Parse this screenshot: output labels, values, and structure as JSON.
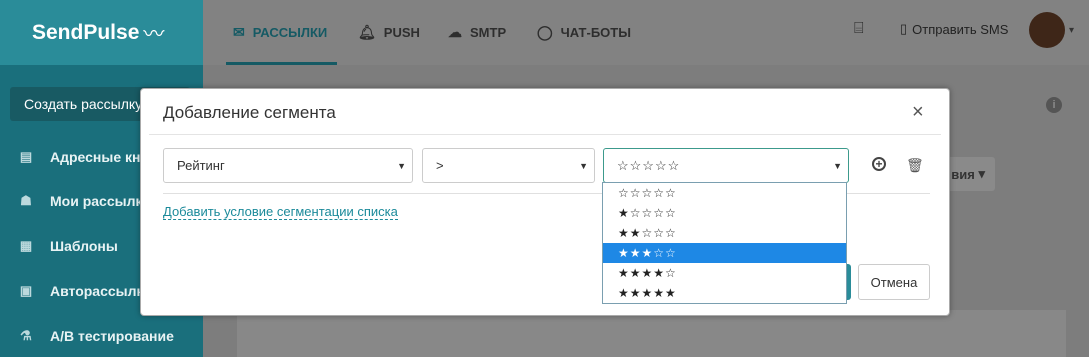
{
  "app": {
    "logo": "SendPulse",
    "logo_mark": "〰"
  },
  "sidebar": {
    "create_button": "Создать рассылку",
    "items": [
      {
        "label": "Адресные книги",
        "icon": "address-book-icon"
      },
      {
        "label": "Мои рассылки",
        "icon": "campaigns-icon"
      },
      {
        "label": "Шаблоны",
        "icon": "templates-icon"
      },
      {
        "label": "Авторассылки",
        "icon": "autoresponder-icon"
      },
      {
        "label": "A/B тестирование",
        "icon": "ab-test-icon"
      }
    ]
  },
  "topnav": {
    "items": [
      {
        "label": "РАССЫЛКИ",
        "icon": "mail-icon",
        "active": true
      },
      {
        "label": "PUSH",
        "icon": "bell-icon"
      },
      {
        "label": "SMTP",
        "icon": "cloud-icon"
      },
      {
        "label": "ЧАТ-БОТЫ",
        "icon": "chat-icon"
      }
    ],
    "sms_label": "Отправить SMS"
  },
  "background": {
    "actions_label": "вия"
  },
  "modal": {
    "title": "Добавление сегмента",
    "field_select": "Рейтинг",
    "operator_select": ">",
    "value_select": "☆☆☆☆☆",
    "add_condition_link": "Добавить условие сегментации списка",
    "cancel_button": "Отмена"
  },
  "rating_options": [
    "☆☆☆☆☆",
    "★☆☆☆☆",
    "★★☆☆☆",
    "★★★☆☆",
    "★★★★☆",
    "★★★★★"
  ],
  "selected_option_index": 3,
  "colors": {
    "sidebar": "#1a6f7c",
    "accent": "#2a8c99",
    "highlight": "#1e88e5"
  }
}
